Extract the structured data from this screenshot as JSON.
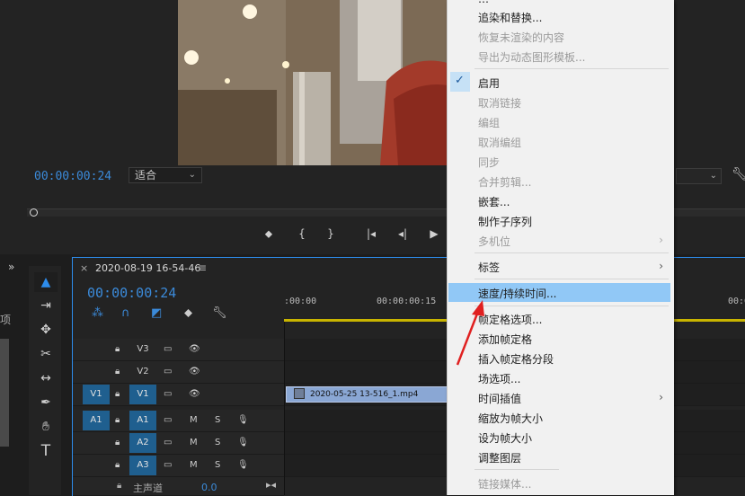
{
  "monitor": {
    "timecode": "00:00:00:24",
    "fit_label": "适合",
    "controls": [
      "mark-in",
      "mark-out",
      "go-to-in",
      "step-back",
      "play"
    ]
  },
  "left_panel": {
    "chevrons": "»",
    "item_text": "项"
  },
  "timeline": {
    "sequence_name": "2020-08-19 16-54-46",
    "timecode": "00:00:00:24",
    "ruler": [
      ":00:00",
      "00:00:00:15",
      "00:0"
    ],
    "clip_name": "2020-05-25 13-516_1.mp4",
    "tracks": {
      "video": [
        {
          "target": "",
          "name": "V3"
        },
        {
          "target": "",
          "name": "V2"
        },
        {
          "target": "V1",
          "name": "V1"
        }
      ],
      "audio": [
        {
          "target": "A1",
          "name": "A1",
          "m": "M",
          "s": "S"
        },
        {
          "target": "",
          "name": "A2",
          "m": "M",
          "s": "S"
        },
        {
          "target": "",
          "name": "A3",
          "m": "M",
          "s": "S"
        }
      ]
    },
    "master": {
      "label": "主声道",
      "value": "0.0"
    }
  },
  "context_menu": {
    "items": [
      {
        "label": "追染和替换...",
        "disabled": false
      },
      {
        "label": "恢复未渲染的内容",
        "disabled": true
      },
      {
        "label": "导出为动态图形模板...",
        "disabled": true
      },
      {
        "label": "启用",
        "disabled": false,
        "checked": true
      },
      {
        "label": "取消链接",
        "disabled": true
      },
      {
        "label": "编组",
        "disabled": true
      },
      {
        "label": "取消编组",
        "disabled": true
      },
      {
        "label": "同步",
        "disabled": true
      },
      {
        "label": "合并剪辑...",
        "disabled": true
      },
      {
        "label": "嵌套...",
        "disabled": false
      },
      {
        "label": "制作子序列",
        "disabled": false
      },
      {
        "label": "多机位",
        "disabled": true,
        "submenu": true
      },
      {
        "label": "标签",
        "disabled": false,
        "submenu": true
      },
      {
        "label": "速度/持续时间...",
        "disabled": false,
        "highlighted": true
      },
      {
        "label": "帧定格选项...",
        "disabled": false
      },
      {
        "label": "添加帧定格",
        "disabled": false
      },
      {
        "label": "插入帧定格分段",
        "disabled": false
      },
      {
        "label": "场选项...",
        "disabled": false
      },
      {
        "label": "时间插值",
        "disabled": false,
        "submenu": true
      },
      {
        "label": "缩放为帧大小",
        "disabled": false
      },
      {
        "label": "设为帧大小",
        "disabled": false
      },
      {
        "label": "调整图层",
        "disabled": false
      },
      {
        "label": "链接媒体...",
        "disabled": true
      }
    ]
  },
  "colors": {
    "accent": "#2d8ceb",
    "timecode": "#3b8ad9",
    "menu_highlight": "#91c8f6",
    "arrow": "#e02020"
  }
}
